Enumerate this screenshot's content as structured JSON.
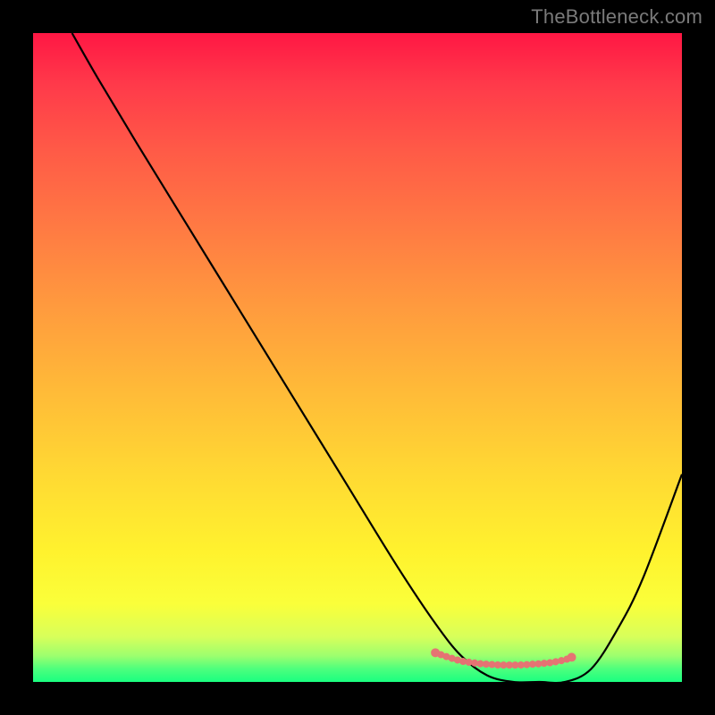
{
  "watermark": "TheBottleneck.com",
  "chart_data": {
    "type": "line",
    "title": "",
    "xlabel": "",
    "ylabel": "",
    "xlim": [
      0,
      100
    ],
    "ylim": [
      0,
      100
    ],
    "gradient_stops": [
      {
        "pos": 0,
        "color": "#ff1744"
      },
      {
        "pos": 8,
        "color": "#ff3a4a"
      },
      {
        "pos": 18,
        "color": "#ff5a47"
      },
      {
        "pos": 30,
        "color": "#ff7a43"
      },
      {
        "pos": 42,
        "color": "#ff9a3e"
      },
      {
        "pos": 55,
        "color": "#ffba38"
      },
      {
        "pos": 68,
        "color": "#ffd933"
      },
      {
        "pos": 80,
        "color": "#fff22e"
      },
      {
        "pos": 88,
        "color": "#faff3a"
      },
      {
        "pos": 93,
        "color": "#d8ff5a"
      },
      {
        "pos": 96,
        "color": "#9cff6e"
      },
      {
        "pos": 98,
        "color": "#4dff7d"
      },
      {
        "pos": 100,
        "color": "#1aff80"
      }
    ],
    "series": [
      {
        "name": "bottleneck-curve",
        "x": [
          6,
          10,
          16,
          24,
          32,
          40,
          48,
          56,
          62,
          66,
          70,
          74,
          78,
          82,
          86,
          90,
          94,
          100
        ],
        "y": [
          100,
          93,
          83,
          70,
          57,
          44,
          31,
          18,
          9,
          4,
          1,
          0,
          0,
          0,
          2,
          8,
          16,
          32
        ]
      }
    ],
    "markers": {
      "name": "valley-dots",
      "x": [
        62,
        64,
        66,
        69,
        72,
        75,
        78,
        80,
        82,
        83
      ],
      "y": [
        4.5,
        3.8,
        3.2,
        2.8,
        2.6,
        2.6,
        2.8,
        3.0,
        3.4,
        3.8
      ]
    },
    "curve_style": {
      "main_color": "#000000",
      "main_width": 2.2,
      "marker_color": "#e57373",
      "marker_radius": 4
    }
  }
}
